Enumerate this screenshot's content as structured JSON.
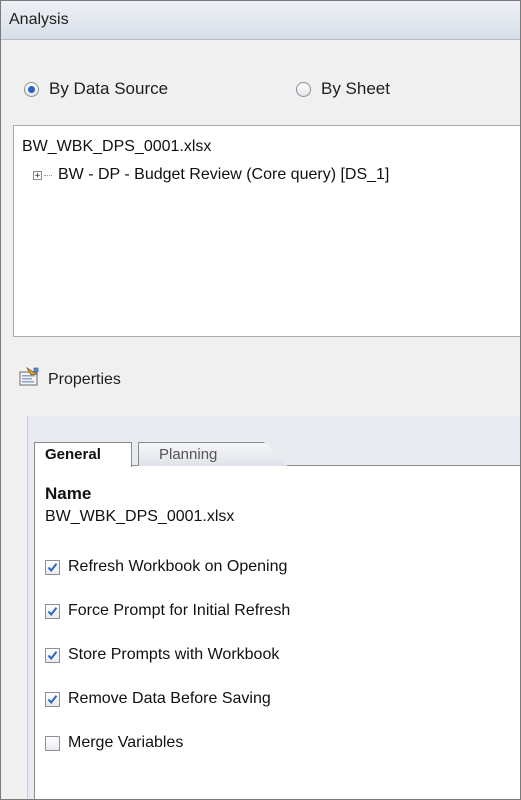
{
  "header": {
    "title": "Analysis"
  },
  "view_mode": {
    "options": [
      {
        "label": "By Data Source",
        "selected": true
      },
      {
        "label": "By Sheet",
        "selected": false
      }
    ]
  },
  "tree": {
    "root": "BW_WBK_DPS_0001.xlsx",
    "children": [
      {
        "label": "BW - DP - Budget Review (Core query) [DS_1]",
        "expander": "+"
      }
    ]
  },
  "properties": {
    "title": "Properties",
    "icon": "properties-icon",
    "tabs": [
      {
        "label": "General",
        "active": true
      },
      {
        "label": "Planning",
        "active": false
      }
    ],
    "general": {
      "name_label": "Name",
      "name_value": "BW_WBK_DPS_0001.xlsx",
      "options": [
        {
          "label": "Refresh Workbook on Opening",
          "checked": true
        },
        {
          "label": "Force Prompt for Initial Refresh",
          "checked": true
        },
        {
          "label": "Store Prompts with Workbook",
          "checked": true
        },
        {
          "label": "Remove Data Before Saving",
          "checked": true
        },
        {
          "label": "Merge Variables",
          "checked": false
        }
      ]
    }
  },
  "colors": {
    "accent": "#2b62c6",
    "check": "#2b62c6"
  }
}
